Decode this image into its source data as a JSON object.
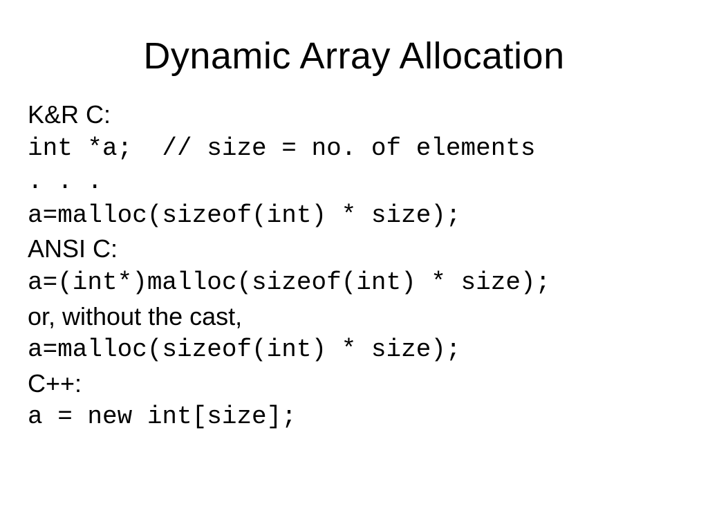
{
  "title": "Dynamic Array Allocation",
  "lines": [
    {
      "cls": "sans",
      "text": "K&R C:"
    },
    {
      "cls": "mono",
      "text": "int *a;  // size = no. of elements"
    },
    {
      "cls": "mono",
      "text": ". . ."
    },
    {
      "cls": "mono",
      "text": "a=malloc(sizeof(int) * size);"
    },
    {
      "cls": "sans",
      "text": "ANSI C:"
    },
    {
      "cls": "mono",
      "text": "a=(int*)malloc(sizeof(int) * size);"
    },
    {
      "cls": "sans",
      "text": "or, without the cast,"
    },
    {
      "cls": "mono",
      "text": "a=malloc(sizeof(int) * size);"
    },
    {
      "cls": "sans",
      "text": "C++:"
    },
    {
      "cls": "mono",
      "text": "a = new int[size];"
    }
  ]
}
